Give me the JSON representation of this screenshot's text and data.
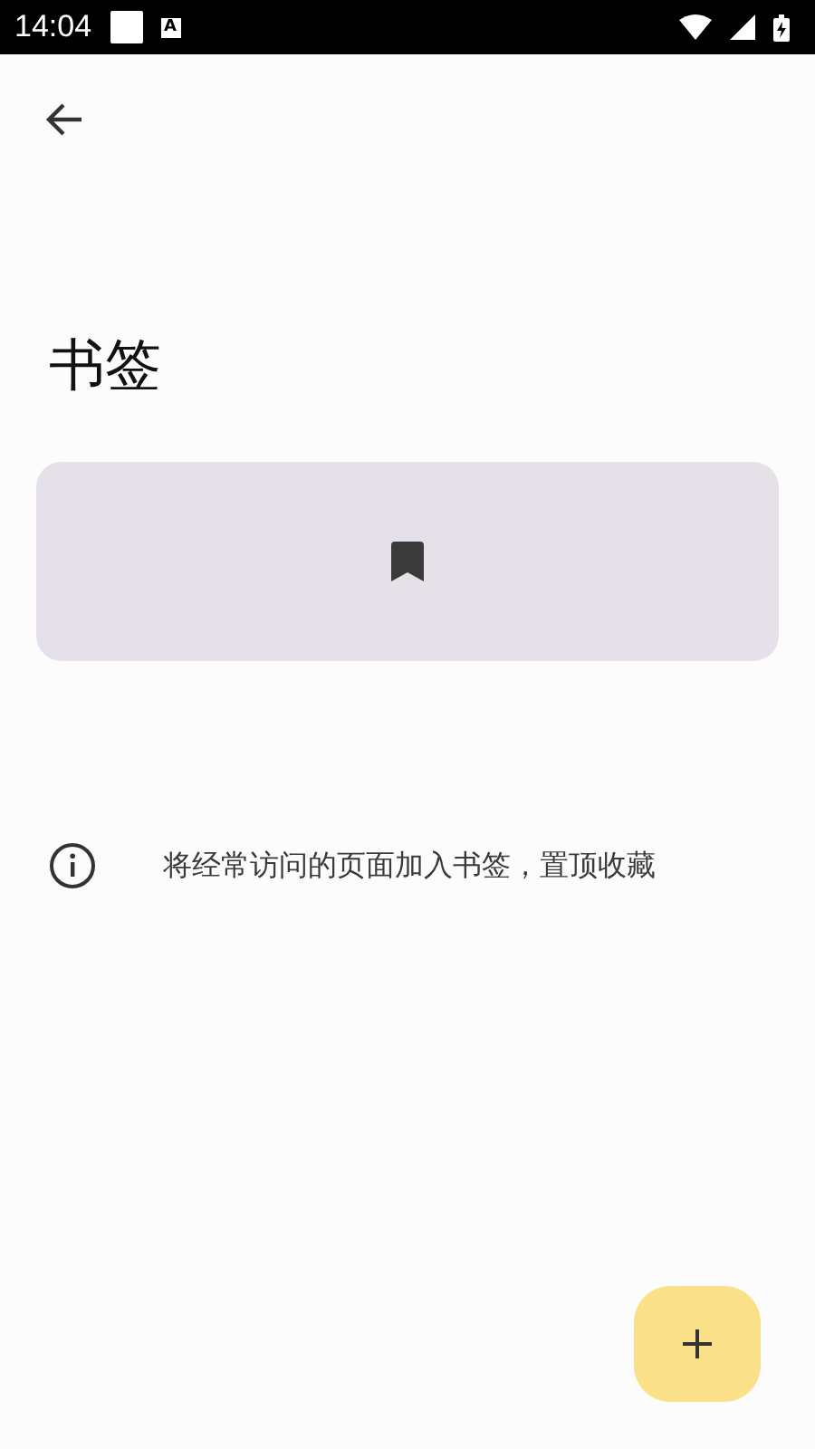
{
  "status_bar": {
    "time": "14:04",
    "notification_letter": "A"
  },
  "title": "书签",
  "empty_card": {
    "kind": "bookmark"
  },
  "hint": {
    "text": "将经常访问的页面加入书签，置顶收藏"
  },
  "fab": {
    "kind": "add"
  }
}
